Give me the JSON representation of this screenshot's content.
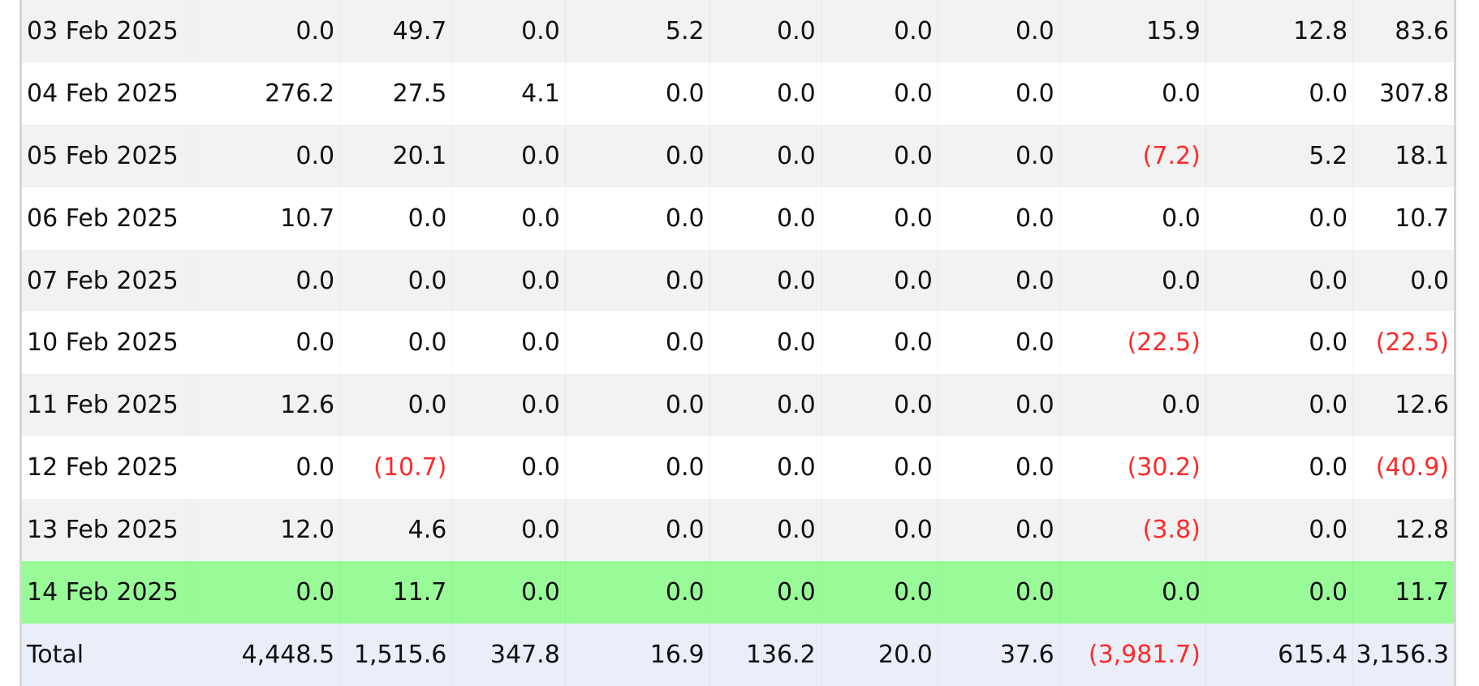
{
  "table": {
    "rows": [
      {
        "date": "03 Feb 2025",
        "values": [
          "0.0",
          "49.7",
          "0.0",
          "5.2",
          "0.0",
          "0.0",
          "0.0",
          "15.9",
          "12.8",
          "83.6"
        ]
      },
      {
        "date": "04 Feb 2025",
        "values": [
          "276.2",
          "27.5",
          "4.1",
          "0.0",
          "0.0",
          "0.0",
          "0.0",
          "0.0",
          "0.0",
          "307.8"
        ]
      },
      {
        "date": "05 Feb 2025",
        "values": [
          "0.0",
          "20.1",
          "0.0",
          "0.0",
          "0.0",
          "0.0",
          "0.0",
          "(7.2)",
          "5.2",
          "18.1"
        ]
      },
      {
        "date": "06 Feb 2025",
        "values": [
          "10.7",
          "0.0",
          "0.0",
          "0.0",
          "0.0",
          "0.0",
          "0.0",
          "0.0",
          "0.0",
          "10.7"
        ]
      },
      {
        "date": "07 Feb 2025",
        "values": [
          "0.0",
          "0.0",
          "0.0",
          "0.0",
          "0.0",
          "0.0",
          "0.0",
          "0.0",
          "0.0",
          "0.0"
        ]
      },
      {
        "date": "10 Feb 2025",
        "values": [
          "0.0",
          "0.0",
          "0.0",
          "0.0",
          "0.0",
          "0.0",
          "0.0",
          "(22.5)",
          "0.0",
          "(22.5)"
        ]
      },
      {
        "date": "11 Feb 2025",
        "values": [
          "12.6",
          "0.0",
          "0.0",
          "0.0",
          "0.0",
          "0.0",
          "0.0",
          "0.0",
          "0.0",
          "12.6"
        ]
      },
      {
        "date": "12 Feb 2025",
        "values": [
          "0.0",
          "(10.7)",
          "0.0",
          "0.0",
          "0.0",
          "0.0",
          "0.0",
          "(30.2)",
          "0.0",
          "(40.9)"
        ]
      },
      {
        "date": "13 Feb 2025",
        "values": [
          "12.0",
          "4.6",
          "0.0",
          "0.0",
          "0.0",
          "0.0",
          "0.0",
          "(3.8)",
          "0.0",
          "12.8"
        ]
      },
      {
        "date": "14 Feb 2025",
        "values": [
          "0.0",
          "11.7",
          "0.0",
          "0.0",
          "0.0",
          "0.0",
          "0.0",
          "0.0",
          "0.0",
          "11.7"
        ],
        "highlighted": true
      }
    ],
    "total": {
      "label": "Total",
      "values": [
        "4,448.5",
        "1,515.6",
        "347.8",
        "16.9",
        "136.2",
        "20.0",
        "37.6",
        "(3,981.7)",
        "615.4",
        "3,156.3"
      ]
    }
  },
  "colors": {
    "row_alt": "#f2f2f2",
    "row_base": "#ffffff",
    "highlight": "#98fb98",
    "total_bg": "#e9eef8",
    "negative_text": "#ff2a2a"
  }
}
